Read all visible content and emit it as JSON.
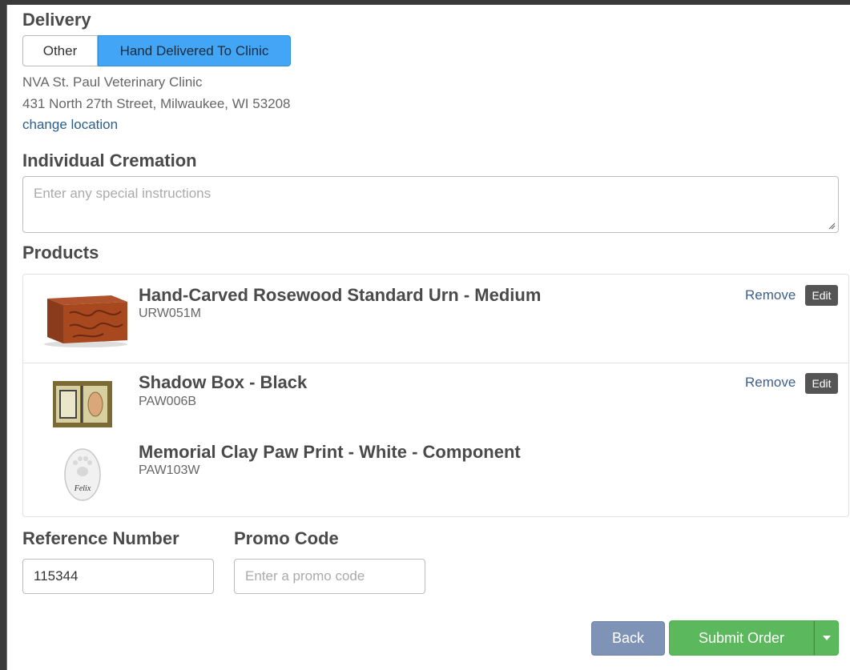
{
  "delivery": {
    "title": "Delivery",
    "options": [
      "Other",
      "Hand Delivered To Clinic"
    ],
    "selected": "Hand Delivered To Clinic",
    "clinic_name": "NVA St. Paul Veterinary Clinic",
    "clinic_address": "431 North 27th Street, Milwaukee, WI 53208",
    "change_location": "change location"
  },
  "cremation": {
    "title": "Individual Cremation",
    "placeholder": "Enter any special instructions"
  },
  "products": {
    "title": "Products",
    "items": [
      {
        "name": "Hand-Carved Rosewood Standard Urn - Medium",
        "sku": "URW051M",
        "remove": "Remove",
        "edit": "Edit",
        "image_icon": "rosewood-urn"
      },
      {
        "name": "Shadow Box - Black",
        "sku": "PAW006B",
        "remove": "Remove",
        "edit": "Edit",
        "image_icon": "shadow-box"
      },
      {
        "name": "Memorial Clay Paw Print - White - Component",
        "sku": "PAW103W",
        "image_icon": "clay-paw-print",
        "image_text": "Felix"
      }
    ]
  },
  "reference": {
    "label": "Reference Number",
    "value": "115344"
  },
  "promo": {
    "label": "Promo Code",
    "placeholder": "Enter a promo code"
  },
  "actions": {
    "back": "Back",
    "submit": "Submit Order"
  },
  "colors": {
    "selected_toggle": "#42a5f5",
    "back_button": "#7f93b7",
    "submit_button": "#5cb85c"
  }
}
